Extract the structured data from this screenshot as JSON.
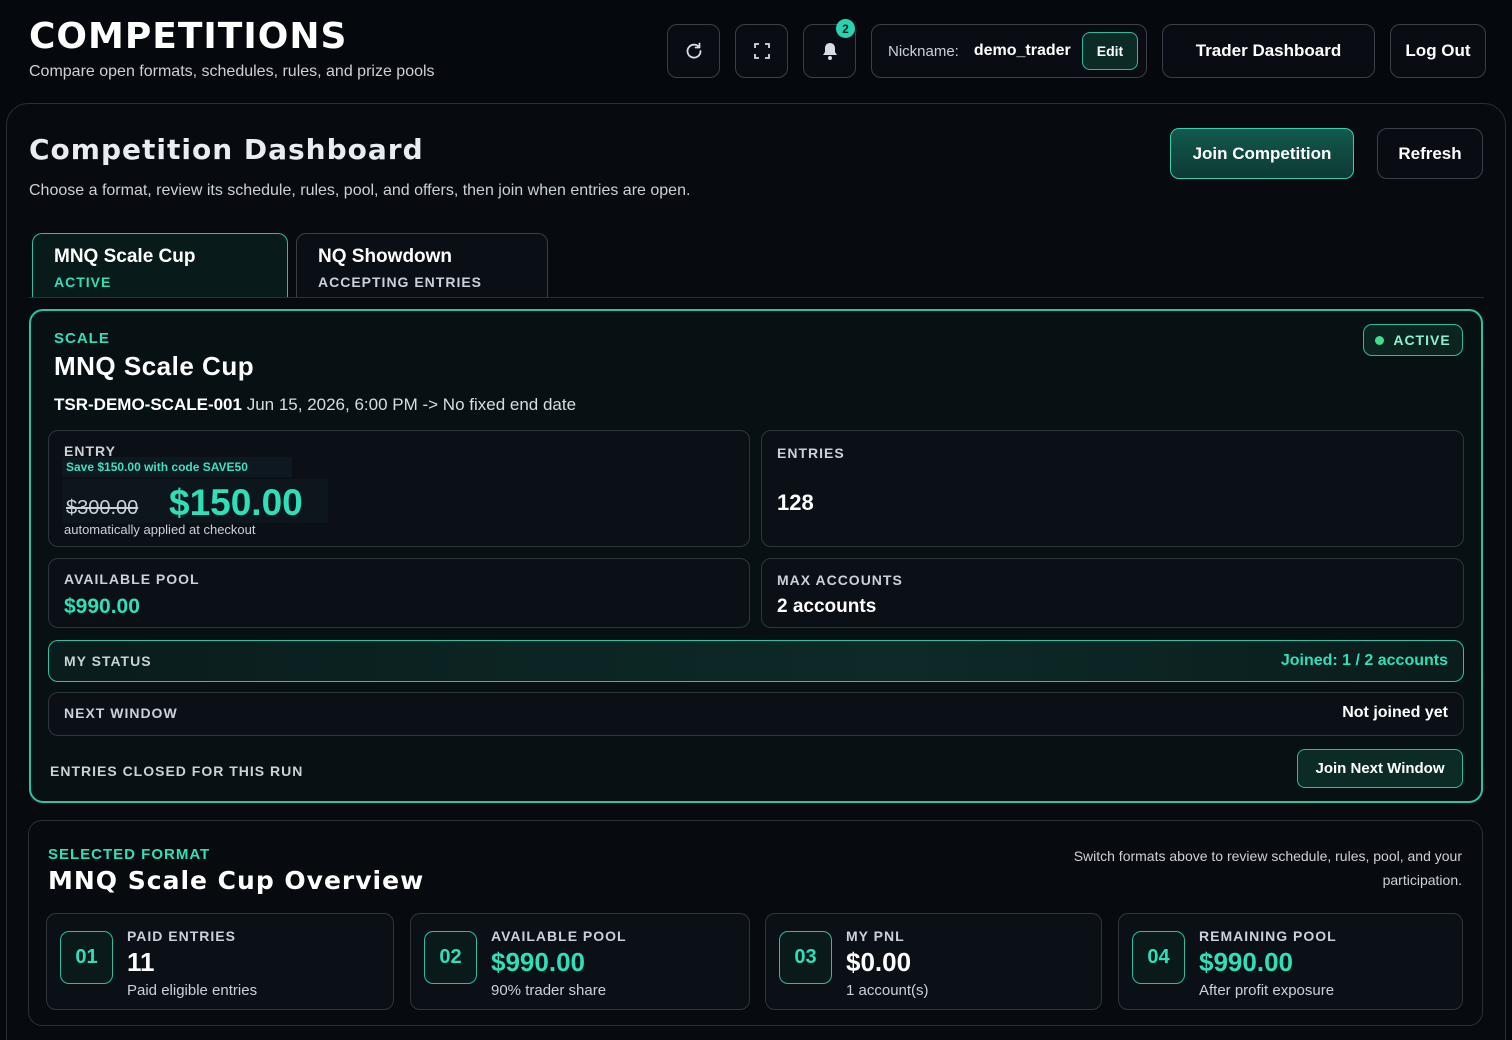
{
  "header": {
    "title": "COMPETITIONS",
    "subtitle": "Compare open formats, schedules, rules, and prize pools",
    "notification_count": "2",
    "nickname_label": "Nickname:",
    "nickname_value": "demo_trader",
    "edit_label": "Edit",
    "trader_dashboard_label": "Trader Dashboard",
    "logout_label": "Log Out"
  },
  "dashboard": {
    "title": "Competition Dashboard",
    "subtitle": "Choose a format, review its schedule, rules, pool, and offers, then join when entries are open.",
    "join_label": "Join Competition",
    "refresh_label": "Refresh"
  },
  "tabs": [
    {
      "name": "MNQ Scale Cup",
      "status": "ACTIVE"
    },
    {
      "name": "NQ Showdown",
      "status": "ACCEPTING ENTRIES"
    }
  ],
  "competition": {
    "kicker": "SCALE",
    "name": "MNQ Scale Cup",
    "status": "ACTIVE",
    "code": "TSR-DEMO-SCALE-001",
    "schedule": "Jun 15, 2026, 6:00 PM -> No fixed end date",
    "entry": {
      "label": "ENTRY",
      "promo": "Save $150.00 with code SAVE50",
      "original_price": "$300.00",
      "price": "$150.00",
      "note": "automatically applied at checkout"
    },
    "entries": {
      "label": "ENTRIES",
      "value": "128"
    },
    "available_pool": {
      "label": "AVAILABLE POOL",
      "value": "$990.00"
    },
    "max_accounts": {
      "label": "MAX ACCOUNTS",
      "value": "2 accounts"
    },
    "my_status": {
      "label": "MY STATUS",
      "value": "Joined: 1 / 2 accounts"
    },
    "next_window": {
      "label": "NEXT WINDOW",
      "value": "Not joined yet"
    },
    "closed_text": "ENTRIES CLOSED FOR THIS RUN",
    "join_next_label": "Join Next Window"
  },
  "overview": {
    "kicker": "SELECTED FORMAT",
    "title": "MNQ Scale Cup Overview",
    "hint": "Switch formats above to review schedule, rules, pool, and your participation.",
    "stats": [
      {
        "num": "01",
        "label": "PAID ENTRIES",
        "value": "11",
        "note": "Paid eligible entries"
      },
      {
        "num": "02",
        "label": "AVAILABLE POOL",
        "value": "$990.00",
        "note": "90% trader share"
      },
      {
        "num": "03",
        "label": "MY PNL",
        "value": "$0.00",
        "note": "1 account(s)"
      },
      {
        "num": "04",
        "label": "REMAINING POOL",
        "value": "$990.00",
        "note": "After profit exposure"
      }
    ]
  },
  "colors": {
    "accent": "#2ee0b8",
    "background": "#05080d",
    "card_border_active": "#28c4a4"
  },
  "icons": [
    "refresh-icon",
    "fullscreen-icon",
    "bell-icon"
  ]
}
